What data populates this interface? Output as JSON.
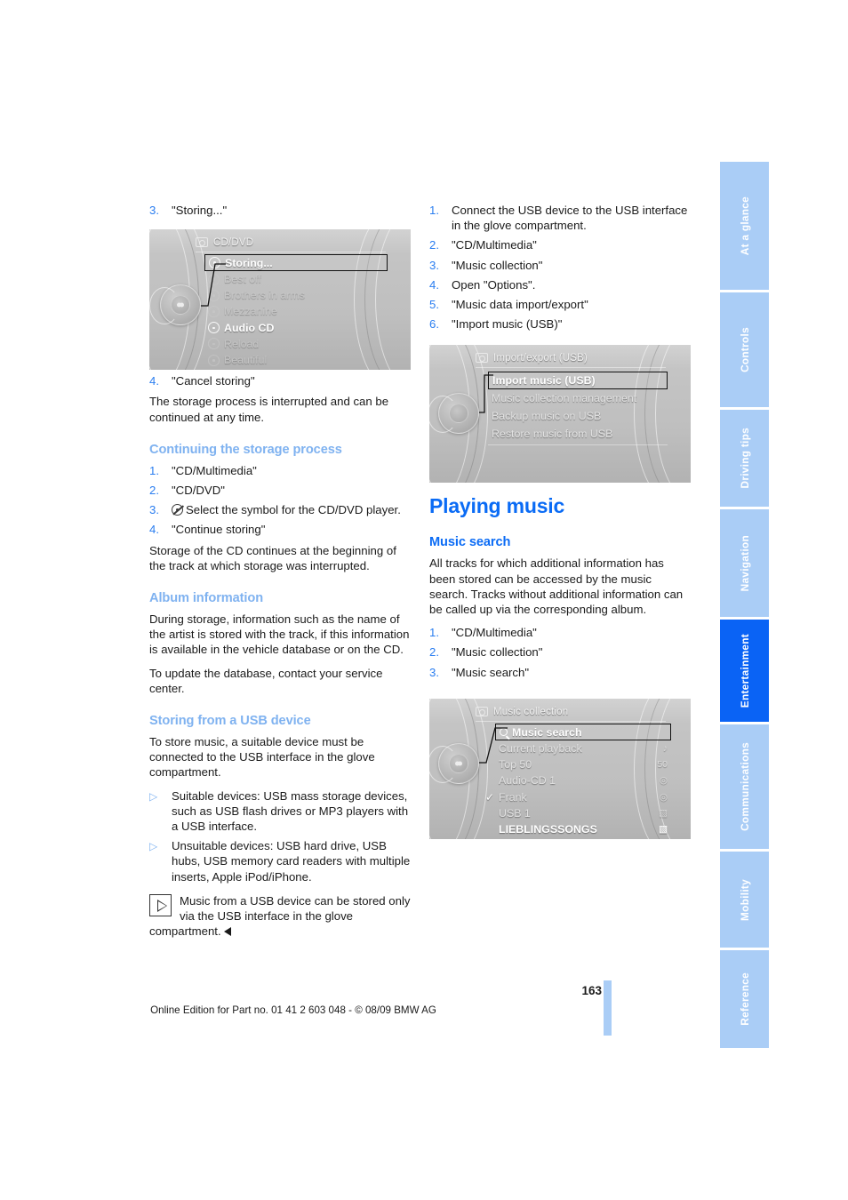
{
  "page": {
    "number": "163",
    "edition_line": "Online Edition for Part no. 01 41 2 603 048 - © 08/09 BMW AG"
  },
  "rail": {
    "tabs": [
      {
        "label": "At a glance",
        "active": false
      },
      {
        "label": "Controls",
        "active": false
      },
      {
        "label": "Driving tips",
        "active": false
      },
      {
        "label": "Navigation",
        "active": false
      },
      {
        "label": "Entertainment",
        "active": true
      },
      {
        "label": "Communications",
        "active": false
      },
      {
        "label": "Mobility",
        "active": false
      },
      {
        "label": "Reference",
        "active": false
      }
    ],
    "active_color": "#0a63f5",
    "inactive_color": "#aacdf6"
  },
  "left_column": {
    "step_3": {
      "num": "3.",
      "text": "\"Storing...\""
    },
    "step_4": {
      "num": "4.",
      "text": "\"Cancel storing\""
    },
    "para_cancel": "The storage process is interrupted and can be continued at any time.",
    "heading_continuing": "Continuing the storage process",
    "continuing_steps": [
      {
        "num": "1.",
        "text": "\"CD/Multimedia\""
      },
      {
        "num": "2.",
        "text": "\"CD/DVD\""
      },
      {
        "num": "3.",
        "text": "Select the symbol for the CD/DVD player."
      },
      {
        "num": "4.",
        "text": "\"Continue storing\""
      }
    ],
    "para_continue": "Storage of the CD continues at the beginning of the track at which storage was interrupted.",
    "heading_album": "Album information",
    "para_album_1": "During storage, information such as the name of the artist is stored with the track, if this information is available in the vehicle database or on the CD.",
    "para_album_2": "To update the database, contact your service center.",
    "heading_usb": "Storing from a USB device",
    "para_usb": "To store music, a suitable device must be connected to the USB interface in the glove compartment.",
    "bullets": [
      "Suitable devices: USB mass storage devices, such as USB flash drives or MP3 players with a USB interface.",
      "Unsuitable devices: USB hard drive, USB hubs, USB memory card readers with multiple inserts, Apple iPod/iPhone."
    ],
    "note": "Music from a USB device can be stored only via the USB interface in the glove compartment."
  },
  "right_column": {
    "usb_steps": [
      {
        "num": "1.",
        "text": "Connect the USB device to the USB interface in the glove compartment."
      },
      {
        "num": "2.",
        "text": "\"CD/Multimedia\""
      },
      {
        "num": "3.",
        "text": "\"Music collection\""
      },
      {
        "num": "4.",
        "text": "Open \"Options\"."
      },
      {
        "num": "5.",
        "text": "\"Music data import/export\""
      },
      {
        "num": "6.",
        "text": "\"Import music (USB)\""
      }
    ],
    "heading_playing": "Playing music",
    "heading_search": "Music search",
    "para_search": "All tracks for which additional information has been stored can be accessed by the music search. Tracks without additional information can be called up via the corresponding album.",
    "search_steps": [
      {
        "num": "1.",
        "text": "\"CD/Multimedia\""
      },
      {
        "num": "2.",
        "text": "\"Music collection\""
      },
      {
        "num": "3.",
        "text": "\"Music search\""
      }
    ]
  },
  "figures": {
    "fig_cd_dvd": {
      "title": "CD/DVD",
      "rows": [
        {
          "label": "Storing...",
          "state": "selected",
          "icon": "disc-icon"
        },
        {
          "label": "Best off",
          "state": "dim",
          "icon": "disc-icon"
        },
        {
          "label": "Brothers in arms",
          "state": "dim",
          "icon": "disc-icon"
        },
        {
          "label": "Mezzanine",
          "state": "dim",
          "icon": "disc-icon"
        },
        {
          "label": "Audio CD",
          "state": "bright",
          "icon": "disc-icon"
        },
        {
          "label": "Reload",
          "state": "dim",
          "icon": "disc-icon"
        },
        {
          "label": "Beautiful",
          "state": "dim",
          "icon": "disc-icon"
        }
      ]
    },
    "fig_import_export": {
      "title": "Import/export (USB)",
      "rows": [
        {
          "label": "Import music (USB)",
          "state": "selected"
        },
        {
          "label": "Music collection management",
          "state": "normal"
        },
        {
          "label": "Backup music on USB",
          "state": "normal"
        },
        {
          "label": "Restore music from USB",
          "state": "normal"
        }
      ]
    },
    "fig_music_collection": {
      "title": "Music collection",
      "rows": [
        {
          "label": "Music search",
          "state": "selected",
          "icon": "search-icon",
          "right": ""
        },
        {
          "label": "Current playback",
          "state": "normal",
          "right": "♪"
        },
        {
          "label": "Top 50",
          "state": "normal",
          "right": "50"
        },
        {
          "label": "Audio-CD 1",
          "state": "normal",
          "right": "◎"
        },
        {
          "label": "Frank",
          "state": "normal",
          "right": "◎",
          "check": "✓"
        },
        {
          "label": "USB 1",
          "state": "normal",
          "right": "▧"
        },
        {
          "label": "LIEBLINGSSONGS",
          "state": "bright",
          "right": "▧"
        }
      ]
    }
  }
}
